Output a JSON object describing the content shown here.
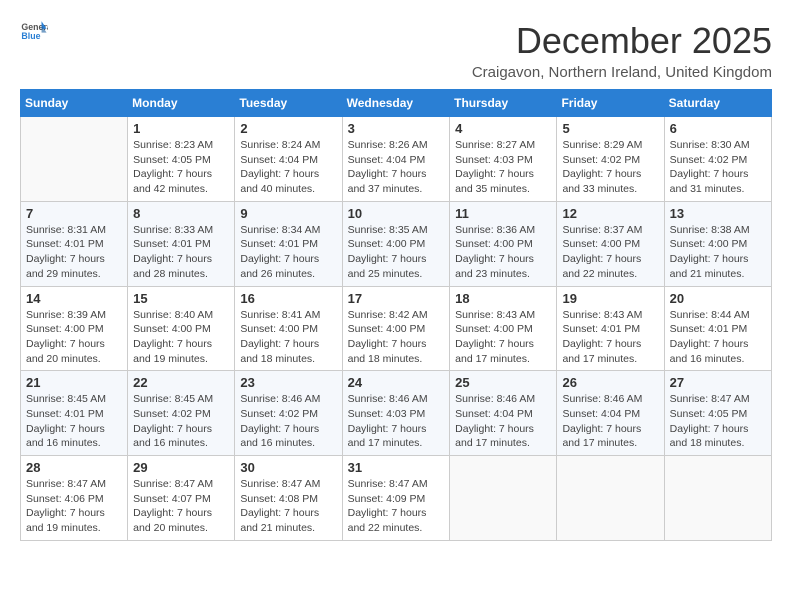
{
  "header": {
    "logo_general": "General",
    "logo_blue": "Blue",
    "month_title": "December 2025",
    "location": "Craigavon, Northern Ireland, United Kingdom"
  },
  "days_of_week": [
    "Sunday",
    "Monday",
    "Tuesday",
    "Wednesday",
    "Thursday",
    "Friday",
    "Saturday"
  ],
  "weeks": [
    [
      {
        "day": "",
        "info": ""
      },
      {
        "day": "1",
        "info": "Sunrise: 8:23 AM\nSunset: 4:05 PM\nDaylight: 7 hours\nand 42 minutes."
      },
      {
        "day": "2",
        "info": "Sunrise: 8:24 AM\nSunset: 4:04 PM\nDaylight: 7 hours\nand 40 minutes."
      },
      {
        "day": "3",
        "info": "Sunrise: 8:26 AM\nSunset: 4:04 PM\nDaylight: 7 hours\nand 37 minutes."
      },
      {
        "day": "4",
        "info": "Sunrise: 8:27 AM\nSunset: 4:03 PM\nDaylight: 7 hours\nand 35 minutes."
      },
      {
        "day": "5",
        "info": "Sunrise: 8:29 AM\nSunset: 4:02 PM\nDaylight: 7 hours\nand 33 minutes."
      },
      {
        "day": "6",
        "info": "Sunrise: 8:30 AM\nSunset: 4:02 PM\nDaylight: 7 hours\nand 31 minutes."
      }
    ],
    [
      {
        "day": "7",
        "info": "Sunrise: 8:31 AM\nSunset: 4:01 PM\nDaylight: 7 hours\nand 29 minutes."
      },
      {
        "day": "8",
        "info": "Sunrise: 8:33 AM\nSunset: 4:01 PM\nDaylight: 7 hours\nand 28 minutes."
      },
      {
        "day": "9",
        "info": "Sunrise: 8:34 AM\nSunset: 4:01 PM\nDaylight: 7 hours\nand 26 minutes."
      },
      {
        "day": "10",
        "info": "Sunrise: 8:35 AM\nSunset: 4:00 PM\nDaylight: 7 hours\nand 25 minutes."
      },
      {
        "day": "11",
        "info": "Sunrise: 8:36 AM\nSunset: 4:00 PM\nDaylight: 7 hours\nand 23 minutes."
      },
      {
        "day": "12",
        "info": "Sunrise: 8:37 AM\nSunset: 4:00 PM\nDaylight: 7 hours\nand 22 minutes."
      },
      {
        "day": "13",
        "info": "Sunrise: 8:38 AM\nSunset: 4:00 PM\nDaylight: 7 hours\nand 21 minutes."
      }
    ],
    [
      {
        "day": "14",
        "info": "Sunrise: 8:39 AM\nSunset: 4:00 PM\nDaylight: 7 hours\nand 20 minutes."
      },
      {
        "day": "15",
        "info": "Sunrise: 8:40 AM\nSunset: 4:00 PM\nDaylight: 7 hours\nand 19 minutes."
      },
      {
        "day": "16",
        "info": "Sunrise: 8:41 AM\nSunset: 4:00 PM\nDaylight: 7 hours\nand 18 minutes."
      },
      {
        "day": "17",
        "info": "Sunrise: 8:42 AM\nSunset: 4:00 PM\nDaylight: 7 hours\nand 18 minutes."
      },
      {
        "day": "18",
        "info": "Sunrise: 8:43 AM\nSunset: 4:00 PM\nDaylight: 7 hours\nand 17 minutes."
      },
      {
        "day": "19",
        "info": "Sunrise: 8:43 AM\nSunset: 4:01 PM\nDaylight: 7 hours\nand 17 minutes."
      },
      {
        "day": "20",
        "info": "Sunrise: 8:44 AM\nSunset: 4:01 PM\nDaylight: 7 hours\nand 16 minutes."
      }
    ],
    [
      {
        "day": "21",
        "info": "Sunrise: 8:45 AM\nSunset: 4:01 PM\nDaylight: 7 hours\nand 16 minutes."
      },
      {
        "day": "22",
        "info": "Sunrise: 8:45 AM\nSunset: 4:02 PM\nDaylight: 7 hours\nand 16 minutes."
      },
      {
        "day": "23",
        "info": "Sunrise: 8:46 AM\nSunset: 4:02 PM\nDaylight: 7 hours\nand 16 minutes."
      },
      {
        "day": "24",
        "info": "Sunrise: 8:46 AM\nSunset: 4:03 PM\nDaylight: 7 hours\nand 17 minutes."
      },
      {
        "day": "25",
        "info": "Sunrise: 8:46 AM\nSunset: 4:04 PM\nDaylight: 7 hours\nand 17 minutes."
      },
      {
        "day": "26",
        "info": "Sunrise: 8:46 AM\nSunset: 4:04 PM\nDaylight: 7 hours\nand 17 minutes."
      },
      {
        "day": "27",
        "info": "Sunrise: 8:47 AM\nSunset: 4:05 PM\nDaylight: 7 hours\nand 18 minutes."
      }
    ],
    [
      {
        "day": "28",
        "info": "Sunrise: 8:47 AM\nSunset: 4:06 PM\nDaylight: 7 hours\nand 19 minutes."
      },
      {
        "day": "29",
        "info": "Sunrise: 8:47 AM\nSunset: 4:07 PM\nDaylight: 7 hours\nand 20 minutes."
      },
      {
        "day": "30",
        "info": "Sunrise: 8:47 AM\nSunset: 4:08 PM\nDaylight: 7 hours\nand 21 minutes."
      },
      {
        "day": "31",
        "info": "Sunrise: 8:47 AM\nSunset: 4:09 PM\nDaylight: 7 hours\nand 22 minutes."
      },
      {
        "day": "",
        "info": ""
      },
      {
        "day": "",
        "info": ""
      },
      {
        "day": "",
        "info": ""
      }
    ]
  ]
}
